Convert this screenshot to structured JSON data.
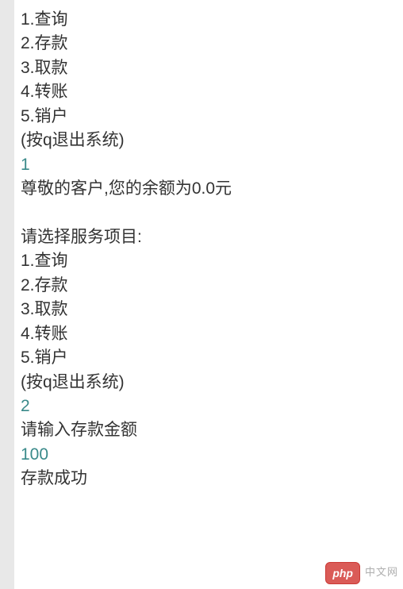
{
  "console": {
    "block1": {
      "menu": [
        "1.查询",
        "2.存款",
        "3.取款",
        "4.转账",
        "5.销户"
      ],
      "hint": "(按q退出系统)",
      "input": "1",
      "response": "尊敬的客户,您的余额为0.0元"
    },
    "block2": {
      "prompt": "请选择服务项目:",
      "menu": [
        "1.查询",
        "2.存款",
        "3.取款",
        "4.转账",
        "5.销户"
      ],
      "hint": "(按q退出系统)",
      "input": "2",
      "deposit_prompt": "请输入存款金额",
      "deposit_input": "100",
      "deposit_result": "存款成功"
    }
  },
  "watermark": {
    "badge": "php",
    "text": "中文网"
  }
}
